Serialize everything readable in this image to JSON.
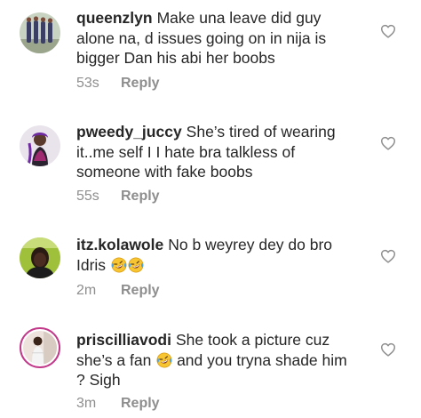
{
  "comments": [
    {
      "username": "queenzlyn",
      "text": "Make una leave did guy alone na, d issues going on in nija is bigger Dan his abi her boobs",
      "time": "53s",
      "reply_label": "Reply",
      "avatar_icon": "avatar-photo",
      "like_icon": "heart-outline-icon"
    },
    {
      "username": "pweedy_juccy",
      "text": "She’s tired of wearing it..me self I I hate bra talkless of someone with fake boobs",
      "time": "55s",
      "reply_label": "Reply",
      "avatar_icon": "avatar-photo",
      "like_icon": "heart-outline-icon"
    },
    {
      "username": "itz.kolawole",
      "text": "No b weyrey dey do bro Idris",
      "emojis": [
        "rolling-on-floor-laughing",
        "rolling-on-floor-laughing"
      ],
      "time": "2m",
      "reply_label": "Reply",
      "avatar_icon": "avatar-photo",
      "like_icon": "heart-outline-icon"
    },
    {
      "username": "priscilliavodi",
      "text_before_emoji": "She took a picture cuz she’s a fan",
      "emojis": [
        "rolling-on-floor-laughing"
      ],
      "text_after_emoji": "and you tryna shade him ? Sigh",
      "time": "3m",
      "reply_label": "Reply",
      "avatar_icon": "avatar-photo-story-ring",
      "like_icon": "heart-outline-icon"
    }
  ],
  "colors": {
    "text": "#262626",
    "secondary": "#8e8e8e",
    "story_ring": "#c2398a",
    "emoji_face": "#f7c531",
    "emoji_tears": "#4aa3e8"
  }
}
